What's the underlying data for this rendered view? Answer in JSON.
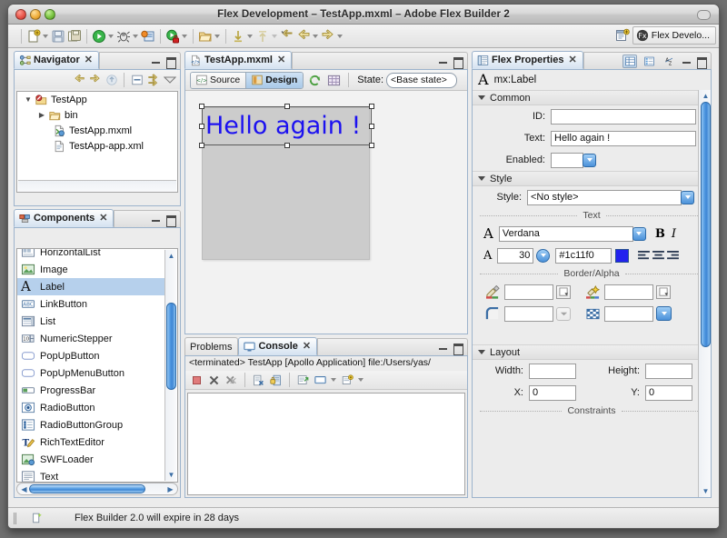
{
  "window": {
    "title": "Flex Development – TestApp.mxml – Adobe Flex Builder 2",
    "traffic": [
      "close-button",
      "minimize-button",
      "zoom-button"
    ]
  },
  "toolbar": {
    "buttons": [
      {
        "name": "new-wizard",
        "icon": "new-file-icon",
        "caret": true
      },
      {
        "name": "save",
        "icon": "save-icon",
        "caret": false
      },
      {
        "name": "save-all",
        "icon": "save-all-icon",
        "caret": false
      },
      {
        "name": "run",
        "icon": "run-icon",
        "caret": true
      },
      {
        "name": "debug",
        "icon": "debug-icon",
        "caret": true
      },
      {
        "name": "profile",
        "icon": "profile-icon",
        "caret": false
      },
      {
        "name": "run-as-secure",
        "icon": "run-secure-icon",
        "caret": true
      },
      {
        "name": "open-type",
        "icon": "open-folder-icon",
        "caret": true
      },
      {
        "name": "next-annotation",
        "icon": "down-arrow-icon",
        "caret": true
      },
      {
        "name": "previous-annotation",
        "icon": "up-arrow-icon",
        "caret": true
      },
      {
        "name": "last-edit-location",
        "icon": "back-pencil-icon",
        "caret": false
      },
      {
        "name": "back",
        "icon": "back-arrow-icon",
        "caret": true
      },
      {
        "name": "forward",
        "icon": "forward-arrow-icon",
        "caret": true
      }
    ],
    "perspective": {
      "open_perspective_label": "",
      "current_label": "Flex Develo..."
    }
  },
  "navigator": {
    "tab_label": "Navigator",
    "toolbar_icons": [
      "back-arrow-icon",
      "forward-arrow-icon",
      "up-home-icon",
      "collapse-all-icon",
      "link-editor-icon",
      "view-menu-icon"
    ],
    "tree": [
      {
        "label": "TestApp",
        "indent": 0,
        "twisty": "down",
        "icon": "project-icon"
      },
      {
        "label": "bin",
        "indent": 1,
        "twisty": "right",
        "icon": "folder-icon"
      },
      {
        "label": "TestApp.mxml",
        "indent": 2,
        "twisty": "none",
        "icon": "mxml-file-icon"
      },
      {
        "label": "TestApp-app.xml",
        "indent": 2,
        "twisty": "none",
        "icon": "xml-file-icon"
      }
    ]
  },
  "components": {
    "tab_label": "Components",
    "items": [
      {
        "label": "HorizontalList",
        "icon": "horizontal-list-icon",
        "selected": false
      },
      {
        "label": "Image",
        "icon": "image-icon",
        "selected": false
      },
      {
        "label": "Label",
        "icon": "label-icon",
        "selected": true
      },
      {
        "label": "LinkButton",
        "icon": "link-button-icon",
        "selected": false
      },
      {
        "label": "List",
        "icon": "list-icon",
        "selected": false
      },
      {
        "label": "NumericStepper",
        "icon": "numeric-stepper-icon",
        "selected": false
      },
      {
        "label": "PopUpButton",
        "icon": "popup-button-icon",
        "selected": false
      },
      {
        "label": "PopUpMenuButton",
        "icon": "popup-menu-button-icon",
        "selected": false
      },
      {
        "label": "ProgressBar",
        "icon": "progress-bar-icon",
        "selected": false
      },
      {
        "label": "RadioButton",
        "icon": "radio-button-icon",
        "selected": false
      },
      {
        "label": "RadioButtonGroup",
        "icon": "radio-button-group-icon",
        "selected": false
      },
      {
        "label": "RichTextEditor",
        "icon": "rich-text-editor-icon",
        "selected": false
      },
      {
        "label": "SWFLoader",
        "icon": "swf-loader-icon",
        "selected": false
      },
      {
        "label": "Text",
        "icon": "text-icon",
        "selected": false
      }
    ]
  },
  "editor": {
    "tab_label": "TestApp.mxml",
    "modes": [
      {
        "label": "Source",
        "active": false,
        "icon": "source-code-icon"
      },
      {
        "label": "Design",
        "active": true,
        "icon": "design-view-icon"
      }
    ],
    "refresh_icon": "refresh-icon",
    "grid_icon": "design-grid-icon",
    "state_label": "State:",
    "state_value": "<Base state>",
    "canvas": {
      "label_text": "Hello again !",
      "label_color": "#1c11f0",
      "canvas_color": "#cccccc"
    }
  },
  "bottom_panel": {
    "tabs": [
      {
        "label": "Problems",
        "active": false,
        "icon": "problems-icon"
      },
      {
        "label": "Console",
        "active": true,
        "icon": "console-icon"
      }
    ],
    "header_text": "<terminated> TestApp [Apollo Application] file:/Users/yas/",
    "toolbar_icons": [
      "terminate-icon",
      "remove-launch-icon",
      "remove-all-terminated-icon",
      "clear-console-icon",
      "scroll-lock-icon",
      "open-console-icon",
      "display-selected-console-icon",
      "new-console-view-icon"
    ]
  },
  "properties": {
    "tab_label": "Flex Properties",
    "view_icons": [
      "category-view-icon",
      "standard-view-icon",
      "alphabetical-view-icon"
    ],
    "selected_type": "mx:Label",
    "sections": {
      "common": {
        "title": "Common",
        "id_label": "ID:",
        "id_value": "",
        "text_label": "Text:",
        "text_value": "Hello again !",
        "enabled_label": "Enabled:",
        "enabled_value": ""
      },
      "style": {
        "title": "Style",
        "style_label": "Style:",
        "style_value": "<No style>",
        "text_divider": "Text",
        "font_family": "Verdana",
        "bold_label": "B",
        "italic_label": "I",
        "font_size": "30",
        "font_color": "#1c11f0",
        "color_swatch": "#2222ee",
        "align_icons": [
          "align-left-icon",
          "align-center-icon",
          "align-right-icon"
        ],
        "border_divider": "Border/Alpha",
        "border_fields": [
          {
            "icon": "fill-color-icon",
            "value": ""
          },
          {
            "icon": "theme-color-icon",
            "value": ""
          },
          {
            "icon": "corner-radius-icon",
            "value": ""
          },
          {
            "icon": "alpha-icon",
            "value": ""
          }
        ]
      },
      "layout": {
        "title": "Layout",
        "width_label": "Width:",
        "width_value": "",
        "height_label": "Height:",
        "height_value": "",
        "x_label": "X:",
        "x_value": "0",
        "y_label": "Y:",
        "y_value": "0",
        "constraints_divider": "Constraints"
      }
    }
  },
  "statusbar": {
    "icon": "expire-notice-icon",
    "text": "Flex Builder 2.0 will expire in 28 days"
  }
}
